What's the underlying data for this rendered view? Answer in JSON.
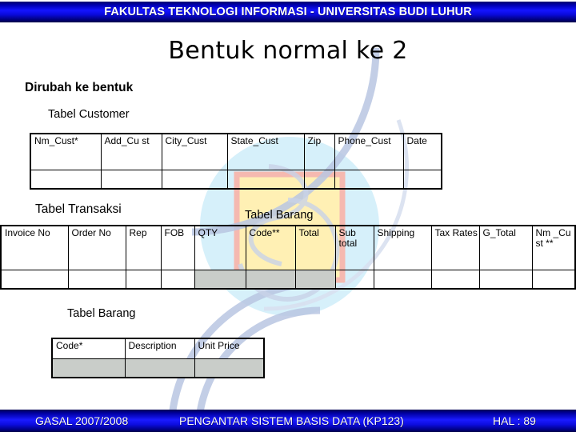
{
  "header": {
    "title": "FAKULTAS TEKNOLOGI INFORMASI - UNIVERSITAS BUDI LUHUR",
    "bar_color": "#1414ff"
  },
  "slide": {
    "title": "Bentuk normal ke 2",
    "subtitle": "Dirubah ke bentuk"
  },
  "captions": {
    "customer": "Tabel Customer",
    "transaksi": "Tabel Transaksi",
    "barang_top": "Tabel Barang",
    "barang_bottom": "Tabel Barang"
  },
  "tables": {
    "customer": {
      "columns": [
        "Nm_Cust*",
        "Add_Cu st",
        "City_Cust",
        "State_Cust",
        "Zip",
        "Phone_Cust",
        "Date"
      ],
      "row": [
        "",
        "",
        "",
        "",
        "",
        "",
        ""
      ]
    },
    "transaksi": {
      "columns": [
        "Invoice No",
        "Order No",
        "Rep",
        "FOB",
        "QTY",
        "Code**",
        "Total",
        "Sub total",
        "Shipping",
        "Tax Rates",
        "G_Total",
        "Nm _Cu st **"
      ],
      "row": [
        "",
        "",
        "",
        "",
        "",
        "",
        "",
        "",
        "",
        "",
        "",
        ""
      ],
      "shaded_columns": [
        4,
        5,
        6
      ]
    },
    "barang": {
      "columns": [
        "Code*",
        "Description",
        "Unit Price"
      ],
      "row": [
        "",
        "",
        ""
      ],
      "shaded_columns": [
        0,
        1,
        2
      ]
    }
  },
  "footer": {
    "term": "GASAL 2007/2008",
    "course": "PENGANTAR SISTEM BASIS DATA (KP123)",
    "page": "HAL : 89"
  }
}
